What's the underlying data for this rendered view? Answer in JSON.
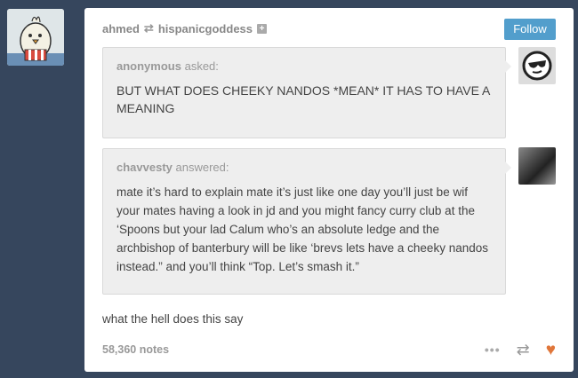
{
  "post": {
    "reblogger": "ahmed",
    "source": "hispanicgoddess",
    "follow_label": "Follow",
    "ask": {
      "asker": "anonymous",
      "verb": "asked:",
      "question": "BUT WHAT DOES CHEEKY NANDOS *MEAN* IT HAS TO HAVE A MEANING"
    },
    "answer": {
      "answerer": "chavvesty",
      "verb": "answered:",
      "text": "mate it’s hard to explain mate it’s just like one day you’ll just be wif your mates having a look in jd and you might fancy curry club at the ‘Spoons but your lad Calum who’s an absolute ledge and the archbishop of banterbury will be like ‘brevs lets have a cheeky nandos instead.” and you’ll think “Top. Let’s smash it.”"
    },
    "caption": "what the hell does this say",
    "notes": "58,360 notes"
  },
  "colors": {
    "background": "#36465d",
    "follow": "#529ecc",
    "heart": "#e0763a"
  },
  "icons": {
    "reblog": "reblog-icon",
    "plus": "plus-icon",
    "more": "more-icon",
    "heart": "heart-icon"
  }
}
